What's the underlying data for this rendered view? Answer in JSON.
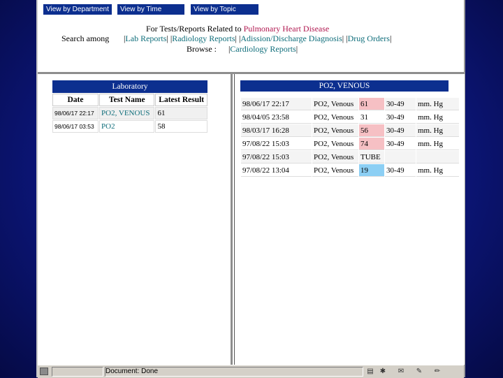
{
  "nav": {
    "by_department": "View by Department",
    "by_time": "View by Time",
    "by_topic": "View by Topic"
  },
  "heading": {
    "prefix": "For Tests/Reports Related to",
    "disease": "Pulmonary Heart Disease"
  },
  "search": {
    "label": "Search among",
    "links": [
      "Lab Reports",
      "Radiology Reports",
      "Adission/Discharge Diagnosis",
      "Drug Orders"
    ]
  },
  "browse": {
    "label": "Browse :",
    "link": "Cardiology Reports"
  },
  "lab": {
    "caption": "Laboratory",
    "headers": [
      "Date",
      "Test Name",
      "Latest Result"
    ],
    "rows": [
      {
        "date": "98/06/17 22:17",
        "test": "PO2, VENOUS",
        "result": "61"
      },
      {
        "date": "98/06/17 03:53",
        "test": "PO2",
        "result": "58"
      }
    ]
  },
  "po2": {
    "caption": "PO2, VENOUS",
    "rows": [
      {
        "date": "98/06/17 22:17",
        "test": "PO2, Venous",
        "value": "61",
        "flag": "high",
        "range": "30-49",
        "unit": "mm. Hg"
      },
      {
        "date": "98/04/05 23:58",
        "test": "PO2, Venous",
        "value": "31",
        "flag": "",
        "range": "30-49",
        "unit": "mm. Hg"
      },
      {
        "date": "98/03/17 16:28",
        "test": "PO2, Venous",
        "value": "56",
        "flag": "high",
        "range": "30-49",
        "unit": "mm. Hg"
      },
      {
        "date": "97/08/22 15:03",
        "test": "PO2, Venous",
        "value": "74",
        "flag": "high",
        "range": "30-49",
        "unit": "mm. Hg"
      },
      {
        "date": "97/08/22 15:03",
        "test": "PO2, Venous",
        "value": "TUBE",
        "flag": "",
        "range": "",
        "unit": ""
      },
      {
        "date": "97/08/22 13:04",
        "test": "PO2, Venous",
        "value": "19",
        "flag": "low",
        "range": "30-49",
        "unit": "mm. Hg"
      }
    ]
  },
  "status": {
    "text": "Document: Done"
  },
  "colors": {
    "nav_bg": "#0c2f8f",
    "disease": "#b01850",
    "link": "#0e6d7a",
    "high": "#f6c0c4",
    "low": "#8ccff4"
  }
}
